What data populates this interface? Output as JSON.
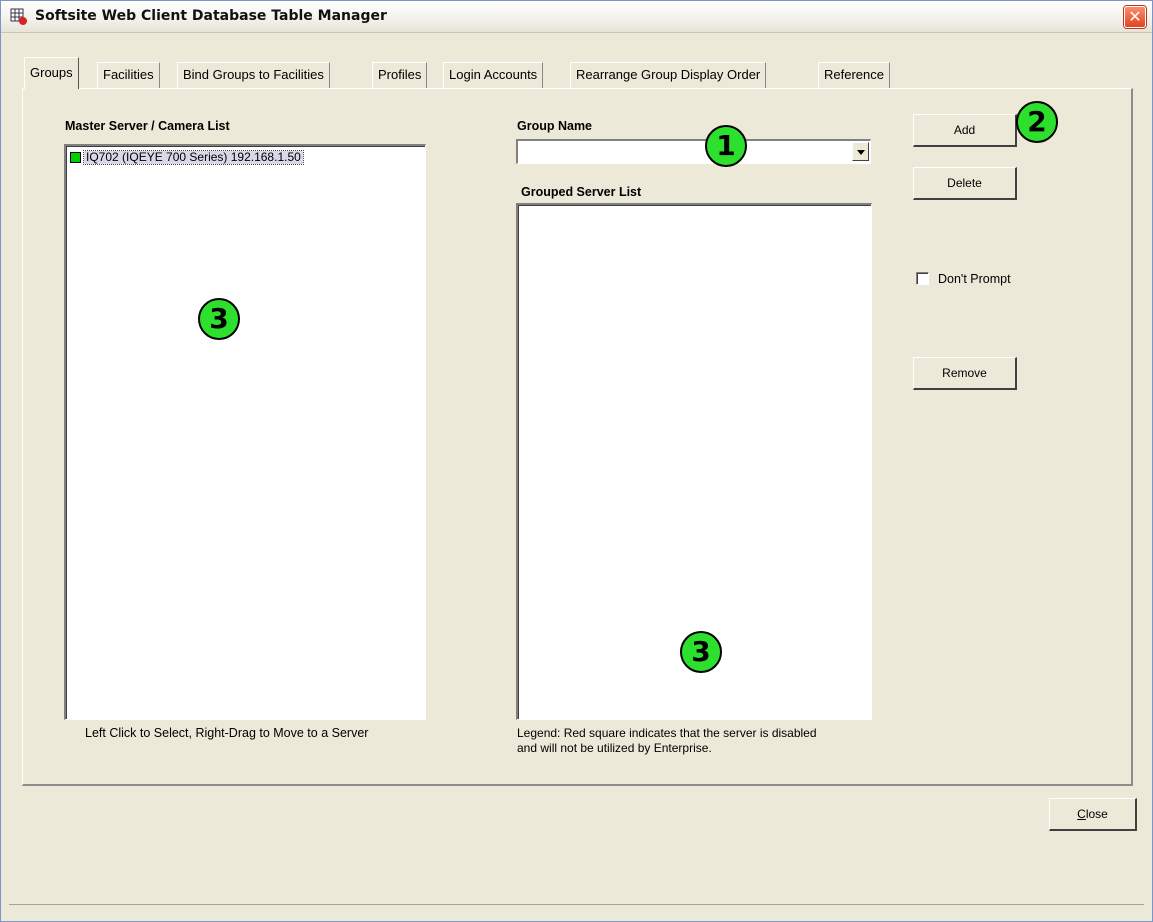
{
  "window": {
    "title": "Softsite Web Client Database Table Manager",
    "close_glyph": "✕"
  },
  "tabs": [
    {
      "label": "Groups",
      "active": true
    },
    {
      "label": "Facilities"
    },
    {
      "label": "Bind Groups to Facilities"
    },
    {
      "label": "Profiles"
    },
    {
      "label": "Login Accounts"
    },
    {
      "label": "Rearrange Group Display Order"
    },
    {
      "label": "Reference"
    }
  ],
  "groups_tab": {
    "master_list_label": "Master Server / Camera List",
    "master_list_items": [
      {
        "text": "IQ702 (IQEYE 700 Series) 192.168.1.50",
        "status_color": "#00d000"
      }
    ],
    "master_list_hint": "Left Click to Select, Right-Drag to Move to a Server",
    "group_name_label": "Group Name",
    "group_name_value": "",
    "grouped_list_label": "Grouped Server List",
    "legend_line1": "Legend: Red square indicates that the server is disabled",
    "legend_line2": "and will not be utilized by Enterprise.",
    "add_button": "Add",
    "delete_button": "Delete",
    "dont_prompt_label": "Don't Prompt",
    "dont_prompt_checked": false,
    "remove_button": "Remove"
  },
  "close_button": {
    "label": "Close",
    "mnemonic": "C",
    "rest": "lose"
  },
  "markers": [
    "1",
    "2",
    "3",
    "3"
  ],
  "colors": {
    "marker": "#2ee02e",
    "window_bg": "#ece9d8"
  }
}
